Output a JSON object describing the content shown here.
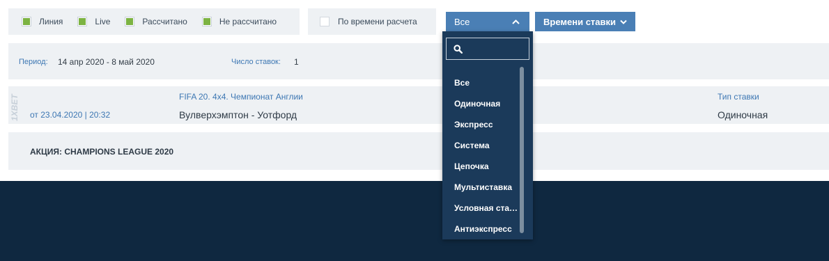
{
  "filters": {
    "items": [
      {
        "label": "Линия"
      },
      {
        "label": "Live"
      },
      {
        "label": "Рассчитано"
      },
      {
        "label": "Не рассчитано"
      }
    ],
    "by_time": "По времени расчета"
  },
  "dropdown_button": {
    "label": "Все",
    "icon": "chevron-up-icon"
  },
  "sort_button": {
    "label": "Времени ставки",
    "icon": "chevron-down-icon"
  },
  "period": {
    "label": "Период:",
    "value": "14 апр 2020 - 8 май 2020",
    "count_label": "Число ставок:",
    "count_value": "1"
  },
  "bet": {
    "brand": "1XBET",
    "date": "от 23.04.2020 | 20:32",
    "championship": "FIFA 20. 4x4. Чемпионат Англии",
    "match": "Вулверхэмптон - Уотфорд",
    "type_header": "Тип ставки",
    "type_value": "Одиночная"
  },
  "promo": {
    "text": "АКЦИЯ: CHAMPIONS LEAGUE 2020"
  },
  "dropdown_menu": {
    "search_placeholder": "",
    "options": [
      "Все",
      "Одиночная",
      "Экспресс",
      "Система",
      "Цепочка",
      "Мультиставка",
      "Условная ставка",
      "Антиэкспресс"
    ]
  },
  "colors": {
    "accent": "#4a7fb5",
    "checkbox_on": "#7cb342",
    "panel_bg": "#eef1f4",
    "dropdown_bg": "#1b3a5a",
    "footer_bg": "#0f2840"
  }
}
